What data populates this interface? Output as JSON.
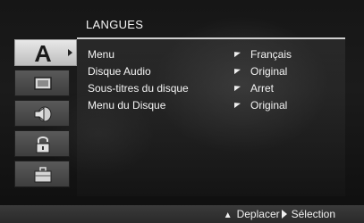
{
  "header": {
    "title": "LANGUES"
  },
  "sidebar": {
    "tabs": [
      {
        "icon": "language-a-icon",
        "active": true
      },
      {
        "icon": "display-icon",
        "active": false
      },
      {
        "icon": "audio-speaker-icon",
        "active": false
      },
      {
        "icon": "lock-icon",
        "active": false
      },
      {
        "icon": "toolbox-icon",
        "active": false
      }
    ]
  },
  "menu": {
    "rows": [
      {
        "label": "Menu",
        "value": "Français"
      },
      {
        "label": "Disque Audio",
        "value": "Original"
      },
      {
        "label": "Sous-titres du disque",
        "value": "Arret"
      },
      {
        "label": "Menu du Disque",
        "value": "Original"
      }
    ]
  },
  "footer": {
    "move_label": "Deplacer",
    "select_label": "Sélection"
  }
}
